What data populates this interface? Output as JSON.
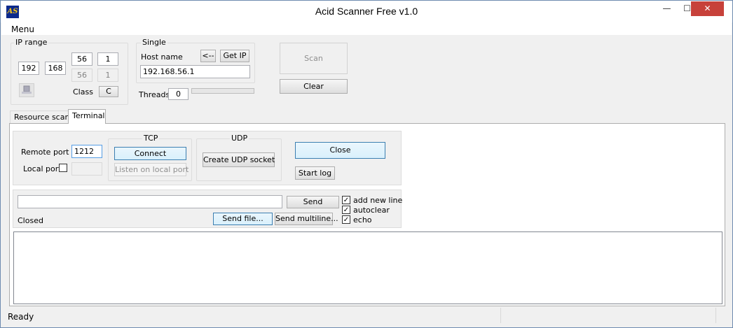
{
  "window": {
    "title": "Acid Scanner Free v1.0",
    "icon_text": "AS",
    "min_glyph": "—",
    "max_glyph": "☐",
    "close_glyph": "✕"
  },
  "menubar": {
    "menu": "Menu"
  },
  "ip_range": {
    "title": "IP range",
    "octet1": "192",
    "octet2": "168",
    "octet3_from": "56",
    "octet3_to": "56",
    "octet4_from": "1",
    "octet4_to": "1",
    "class_label": "Class",
    "class_value": "C"
  },
  "single": {
    "title": "Single",
    "host_label": "Host name",
    "arrow_button": "<--",
    "get_ip_button": "Get IP",
    "host_value": "192.168.56.1"
  },
  "threads": {
    "label": "Threads",
    "value": "0"
  },
  "actions": {
    "scan": "Scan",
    "clear": "Clear"
  },
  "tabs": [
    {
      "label": "Resource scan"
    },
    {
      "label": "Terminal"
    }
  ],
  "terminal": {
    "remote_port_label": "Remote port",
    "remote_port_value": "1212",
    "local_port_label": "Local port",
    "tcp_title": "TCP",
    "connect": "Connect",
    "listen": "Listen on local port",
    "udp_title": "UDP",
    "create_udp": "Create UDP socket",
    "close": "Close",
    "start_log": "Start log",
    "send_input": "",
    "send": "Send",
    "connection_status": "Closed",
    "send_file": "Send file...",
    "send_multiline": "Send multiline...",
    "options": [
      {
        "label": "add new line",
        "checked": true
      },
      {
        "label": "autoclear",
        "checked": true
      },
      {
        "label": "echo",
        "checked": true
      }
    ]
  },
  "status": {
    "text": "Ready"
  }
}
